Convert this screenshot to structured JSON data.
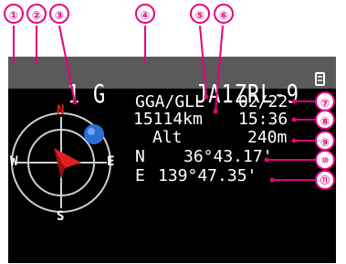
{
  "callouts": {
    "c1": "①",
    "c2": "②",
    "c3": "③",
    "c4": "④",
    "c5": "⑤",
    "c6": "⑥",
    "c7": "⑦",
    "c8": "⑧",
    "c9": "⑨",
    "c10": "⑩",
    "c11": "⑪"
  },
  "status": {
    "channel": "1",
    "group": "G",
    "callsign": "JA1ZRL-9",
    "icon": "speaker-icon"
  },
  "compass": {
    "north": "N",
    "east": "E",
    "south": "S",
    "west": "W"
  },
  "info": {
    "sentence": "GGA/GLL",
    "date": "02/22",
    "distance": "15114km",
    "time": "15:36",
    "alt_label": "Alt",
    "alt_value": "240m",
    "lat_dir": "N",
    "lat_value": "36°43.17'",
    "lon_dir": "E",
    "lon_value": "139°47.35'"
  },
  "colors": {
    "callout": "#e5007e",
    "north": "#e02020",
    "needle": "#e02020",
    "station_dot": "#2a6fd6",
    "lcd_text": "#ffffff",
    "status_bar": "#5a5a5a"
  }
}
